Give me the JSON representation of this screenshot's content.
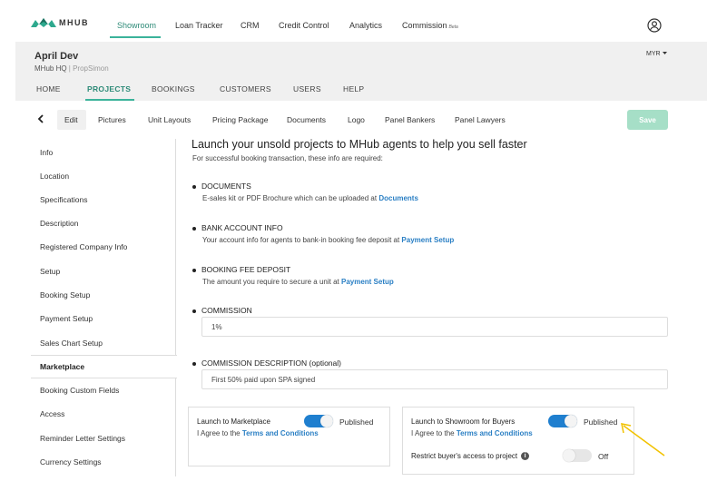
{
  "brand": {
    "logo_text": "MHUB"
  },
  "topnav": {
    "items": [
      {
        "label": "Showroom",
        "active": true
      },
      {
        "label": "Loan Tracker"
      },
      {
        "label": "CRM"
      },
      {
        "label": "Credit Control"
      },
      {
        "label": "Analytics"
      },
      {
        "label": "Commission",
        "badge": "Beta"
      }
    ]
  },
  "project": {
    "name": "April Dev",
    "org": "MHub HQ",
    "separator": " | ",
    "agent": "PropSimon",
    "currency": "MYR",
    "tabs": [
      {
        "label": "HOME"
      },
      {
        "label": "PROJECTS",
        "active": true
      },
      {
        "label": "BOOKINGS"
      },
      {
        "label": "CUSTOMERS"
      },
      {
        "label": "USERS"
      },
      {
        "label": "HELP"
      }
    ]
  },
  "subtabs": {
    "items": [
      {
        "label": "Edit",
        "active": true
      },
      {
        "label": "Pictures"
      },
      {
        "label": "Unit Layouts"
      },
      {
        "label": "Pricing Package"
      },
      {
        "label": "Documents"
      },
      {
        "label": "Logo"
      },
      {
        "label": "Panel Bankers"
      },
      {
        "label": "Panel Lawyers"
      }
    ],
    "save_label": "Save"
  },
  "sidebar": {
    "items": [
      {
        "label": "Info"
      },
      {
        "label": "Location"
      },
      {
        "label": "Specifications"
      },
      {
        "label": "Description"
      },
      {
        "label": "Registered Company Info"
      },
      {
        "label": "Setup"
      },
      {
        "label": "Booking Setup"
      },
      {
        "label": "Payment Setup"
      },
      {
        "label": "Sales Chart Setup"
      },
      {
        "label": "Marketplace",
        "active": true
      },
      {
        "label": "Booking Custom Fields"
      },
      {
        "label": "Access"
      },
      {
        "label": "Reminder Letter Settings"
      },
      {
        "label": "Currency Settings"
      }
    ]
  },
  "main": {
    "headline": "Launch your unsold projects to MHub agents to help you sell faster",
    "subline": "For successful booking transaction, these info are required:",
    "requirements": [
      {
        "title": "DOCUMENTS",
        "desc": "E-sales kit or PDF Brochure which can be uploaded at ",
        "link": "Documents"
      },
      {
        "title": "BANK ACCOUNT INFO",
        "desc": "Your account info for agents to bank-in booking fee deposit at ",
        "link": "Payment Setup"
      },
      {
        "title": "BOOKING FEE DEPOSIT",
        "desc": "The amount you require to secure a unit at ",
        "link": "Payment Setup"
      }
    ],
    "commission": {
      "title": "COMMISSION",
      "value": "1%"
    },
    "commission_desc": {
      "title": "COMMISSION DESCRIPTION (optional)",
      "value": "First 50% paid upon SPA signed"
    }
  },
  "marketplace_card": {
    "title": "Launch to Marketplace",
    "status": "Published",
    "toggle_on": true,
    "agree_prefix": "I Agree to the ",
    "agree_link": "Terms and Conditions"
  },
  "showroom_card": {
    "title": "Launch to Showroom for Buyers",
    "status": "Published",
    "toggle_on": true,
    "agree_prefix": "I Agree to the ",
    "agree_link": "Terms and Conditions",
    "restrict_label": "Restrict buyer's access to project",
    "restrict_status": "Off",
    "restrict_on": false
  },
  "colors": {
    "accent": "#3bb39a",
    "link": "#2a7fc4",
    "toggle_on": "#1f7fcf",
    "save_button": "#a6dfc7",
    "annotation_arrow": "#f2c200"
  }
}
